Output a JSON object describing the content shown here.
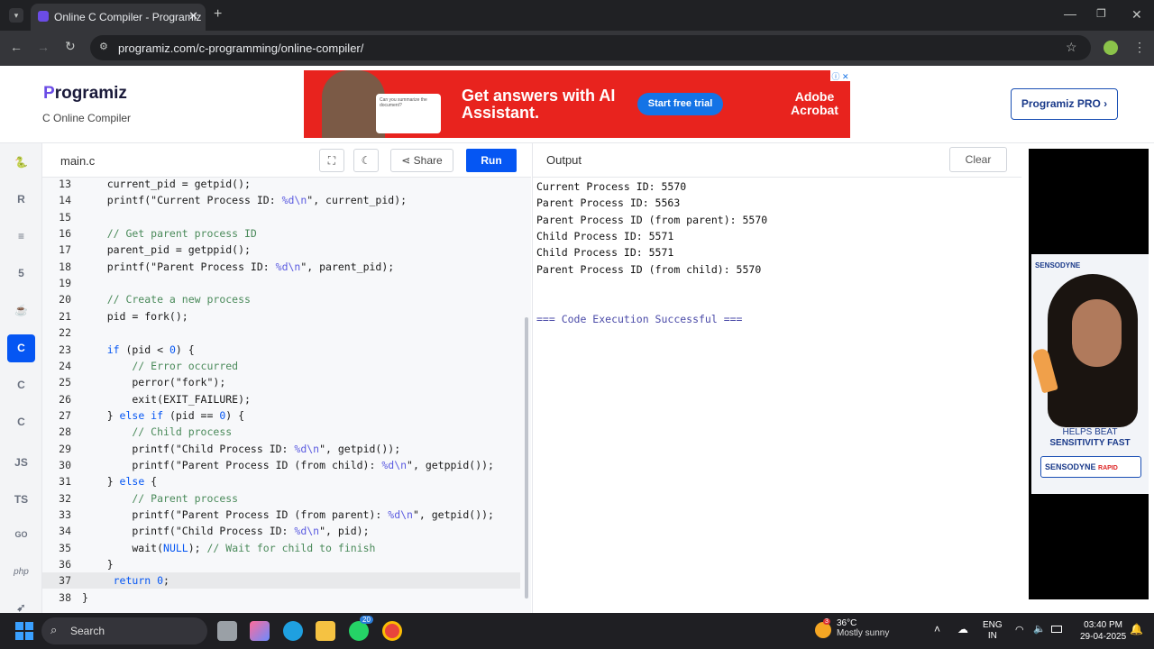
{
  "browser": {
    "tab_title": "Online C Compiler - Programiz",
    "url": "programiz.com/c-programming/online-compiler/"
  },
  "header": {
    "logo": "rogramiz",
    "logo_initial": "P",
    "subtitle": "C Online Compiler",
    "pro_button": "Programiz PRO ›",
    "ad": {
      "headline": "Get answers with AI Assistant.",
      "button": "Start free trial",
      "brand": "Adobe Acrobat",
      "chat_text": "Can you summarize the document?"
    }
  },
  "sidebar": {
    "languages": [
      "python-icon",
      "r-icon",
      "sql-icon",
      "html-icon",
      "java-icon",
      "c-icon",
      "cpp-icon",
      "csharp-icon",
      "JS",
      "TS",
      "GO",
      "php",
      "swift-icon"
    ]
  },
  "editor": {
    "file_tab": "main.c",
    "share_label": "Share",
    "run_label": "Run",
    "lines": [
      {
        "n": "13",
        "parts": [
          [
            "",
            "    current_pid = getpid();"
          ]
        ]
      },
      {
        "n": "14",
        "parts": [
          [
            "",
            "    printf(\"Current Process ID: "
          ],
          [
            "fmt",
            "%d\\n"
          ],
          [
            "",
            "\", current_pid);"
          ]
        ]
      },
      {
        "n": "15",
        "parts": [
          [
            "",
            ""
          ]
        ]
      },
      {
        "n": "16",
        "parts": [
          [
            "com",
            "    // Get parent process ID"
          ]
        ]
      },
      {
        "n": "17",
        "parts": [
          [
            "",
            "    parent_pid = getppid();"
          ]
        ]
      },
      {
        "n": "18",
        "parts": [
          [
            "",
            "    printf(\"Parent Process ID: "
          ],
          [
            "fmt",
            "%d\\n"
          ],
          [
            "",
            "\", parent_pid);"
          ]
        ]
      },
      {
        "n": "19",
        "parts": [
          [
            "",
            ""
          ]
        ]
      },
      {
        "n": "20",
        "parts": [
          [
            "com",
            "    // Create a new process"
          ]
        ]
      },
      {
        "n": "21",
        "parts": [
          [
            "",
            "    pid = fork();"
          ]
        ]
      },
      {
        "n": "22",
        "parts": [
          [
            "",
            ""
          ]
        ]
      },
      {
        "n": "23",
        "parts": [
          [
            "kw",
            "    if"
          ],
          [
            "",
            " (pid < "
          ],
          [
            "num",
            "0"
          ],
          [
            "",
            ") {"
          ]
        ]
      },
      {
        "n": "24",
        "parts": [
          [
            "com",
            "        // Error occurred"
          ]
        ]
      },
      {
        "n": "25",
        "parts": [
          [
            "",
            "        perror(\"fork\");"
          ]
        ]
      },
      {
        "n": "26",
        "parts": [
          [
            "",
            "        exit(EXIT_FAILURE);"
          ]
        ]
      },
      {
        "n": "27",
        "parts": [
          [
            "",
            "    } "
          ],
          [
            "kw",
            "else if"
          ],
          [
            "",
            " (pid == "
          ],
          [
            "num",
            "0"
          ],
          [
            "",
            ") {"
          ]
        ]
      },
      {
        "n": "28",
        "parts": [
          [
            "com",
            "        // Child process"
          ]
        ]
      },
      {
        "n": "29",
        "parts": [
          [
            "",
            "        printf(\"Child Process ID: "
          ],
          [
            "fmt",
            "%d\\n"
          ],
          [
            "",
            "\", getpid());"
          ]
        ]
      },
      {
        "n": "30",
        "parts": [
          [
            "",
            "        printf(\"Parent Process ID (from child): "
          ],
          [
            "fmt",
            "%d\\n"
          ],
          [
            "",
            "\", getppid());"
          ]
        ]
      },
      {
        "n": "31",
        "parts": [
          [
            "",
            "    } "
          ],
          [
            "kw",
            "else"
          ],
          [
            "",
            " {"
          ]
        ]
      },
      {
        "n": "32",
        "parts": [
          [
            "com",
            "        // Parent process"
          ]
        ]
      },
      {
        "n": "33",
        "parts": [
          [
            "",
            "        printf(\"Parent Process ID (from parent): "
          ],
          [
            "fmt",
            "%d\\n"
          ],
          [
            "",
            "\", getpid());"
          ]
        ]
      },
      {
        "n": "34",
        "parts": [
          [
            "",
            "        printf(\"Child Process ID: "
          ],
          [
            "fmt",
            "%d\\n"
          ],
          [
            "",
            "\", pid);"
          ]
        ]
      },
      {
        "n": "35",
        "parts": [
          [
            "",
            "        wait("
          ],
          [
            "kw",
            "NULL"
          ],
          [
            "",
            "); "
          ],
          [
            "com",
            "// Wait for child to finish"
          ]
        ]
      },
      {
        "n": "36",
        "parts": [
          [
            "",
            "    }"
          ]
        ]
      },
      {
        "n": "37",
        "parts": [
          [
            "",
            "     "
          ],
          [
            "kw",
            "return"
          ],
          [
            "",
            " "
          ],
          [
            "num",
            "0"
          ],
          [
            "",
            ";"
          ]
        ]
      },
      {
        "n": "38",
        "parts": [
          [
            "",
            "}"
          ]
        ]
      }
    ]
  },
  "output": {
    "title": "Output",
    "clear_label": "Clear",
    "lines": [
      "Current Process ID: 5570",
      "Parent Process ID: 5563",
      "Parent Process ID (from parent): 5570",
      "Child Process ID: 5571",
      "Child Process ID: 5571",
      "Parent Process ID (from child): 5570",
      "",
      "",
      "=== Code Execution Successful ==="
    ]
  },
  "side_ad": {
    "brand": "SENSODYNE",
    "tagline_1": "HELPS BEAT",
    "tagline_2": "SENSITIVITY FAST",
    "product": "SENSODYNE",
    "product_variant": "RAPID"
  },
  "taskbar": {
    "search": "Search",
    "whatsapp_badge": "20",
    "weather_badge": "3",
    "temperature": "36°C",
    "weather": "Mostly sunny",
    "lang_1": "ENG",
    "lang_2": "IN",
    "time": "03:40 PM",
    "date": "29-04-2025"
  },
  "colors": {
    "accent": "#0556f3",
    "ad_red": "#e8231e",
    "logo_purple": "#6b4ce6"
  }
}
